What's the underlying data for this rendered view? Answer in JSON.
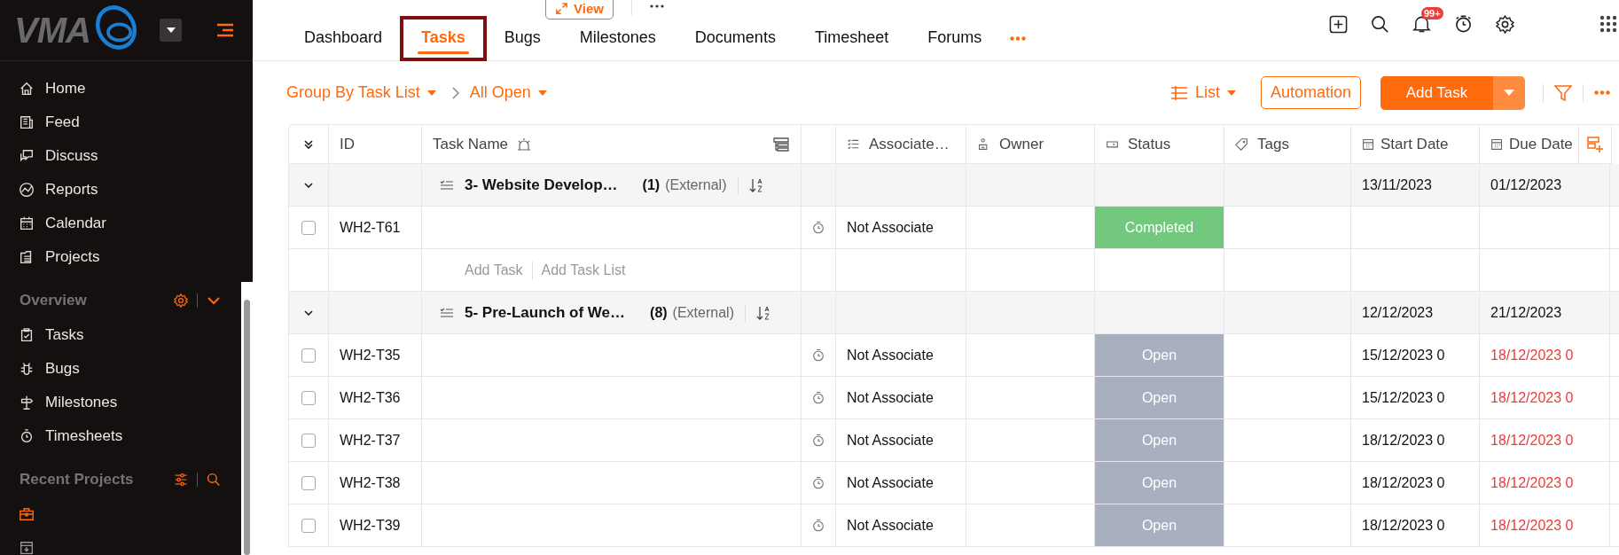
{
  "sidebar": {
    "brand": "VMA",
    "nav": [
      {
        "label": "Home"
      },
      {
        "label": "Feed"
      },
      {
        "label": "Discuss"
      },
      {
        "label": "Reports"
      },
      {
        "label": "Calendar"
      },
      {
        "label": "Projects"
      }
    ],
    "sections": [
      {
        "title": "Overview",
        "items": [
          {
            "label": "Tasks"
          },
          {
            "label": "Bugs"
          },
          {
            "label": "Milestones"
          },
          {
            "label": "Timesheets"
          }
        ]
      },
      {
        "title": "Recent Projects"
      }
    ]
  },
  "top": {
    "view_button": "View",
    "notification_badge": "99+",
    "tabs": [
      {
        "label": "Dashboard",
        "selected": false,
        "highlighted": false
      },
      {
        "label": "Tasks",
        "selected": true,
        "highlighted": true
      },
      {
        "label": "Bugs",
        "selected": false,
        "highlighted": false
      },
      {
        "label": "Milestones",
        "selected": false,
        "highlighted": false
      },
      {
        "label": "Documents",
        "selected": false,
        "highlighted": false
      },
      {
        "label": "Timesheet",
        "selected": false,
        "highlighted": false
      },
      {
        "label": "Forums",
        "selected": false,
        "highlighted": false
      }
    ]
  },
  "toolbar": {
    "group_by": "Group By Task List",
    "filter": "All Open",
    "view_mode": "List",
    "automation": "Automation",
    "add_task": "Add Task"
  },
  "table": {
    "columns": [
      "ID",
      "Task Name",
      "Associate…",
      "Owner",
      "Status",
      "Tags",
      "Start Date",
      "Due Date"
    ],
    "rows": [
      {
        "kind": "group",
        "expanded": true,
        "title": "3- Website Develop…",
        "count": "(1)",
        "scope": "(External)",
        "start": "13/11/2023",
        "due": "01/12/2023"
      },
      {
        "kind": "task",
        "id": "WH2-T61",
        "checked": false,
        "associated": "Not Associate",
        "status": "Completed",
        "color": "#72c97e"
      },
      {
        "kind": "add",
        "add_task": "Add Task",
        "add_task_list": "Add Task List"
      },
      {
        "kind": "group",
        "expanded": true,
        "title": "5- Pre-Launch of We…",
        "count": "(8)",
        "scope": "(External)",
        "start": "12/12/2023",
        "due": "21/12/2023"
      },
      {
        "kind": "task",
        "id": "WH2-T35",
        "checked": false,
        "associated": "Not Associate",
        "status": "Open",
        "color": "#a8b0bf",
        "start": "15/12/2023 0",
        "due": "18/12/2023 0",
        "overdue": true
      },
      {
        "kind": "task",
        "id": "WH2-T36",
        "checked": false,
        "associated": "Not Associate",
        "status": "Open",
        "color": "#a8b0bf",
        "start": "15/12/2023 0",
        "due": "18/12/2023 0",
        "overdue": true
      },
      {
        "kind": "task",
        "id": "WH2-T37",
        "checked": false,
        "associated": "Not Associate",
        "status": "Open",
        "color": "#a8b0bf",
        "start": "18/12/2023 0",
        "due": "18/12/2023 0",
        "overdue": true
      },
      {
        "kind": "task",
        "id": "WH2-T38",
        "checked": false,
        "associated": "Not Associate",
        "status": "Open",
        "color": "#a8b0bf",
        "start": "18/12/2023 0",
        "due": "18/12/2023 0",
        "overdue": true
      },
      {
        "kind": "task",
        "id": "WH2-T39",
        "checked": false,
        "associated": "Not Associate",
        "status": "Open",
        "color": "#a8b0bf",
        "start": "18/12/2023 0",
        "due": "18/12/2023 0",
        "overdue": true
      }
    ]
  }
}
